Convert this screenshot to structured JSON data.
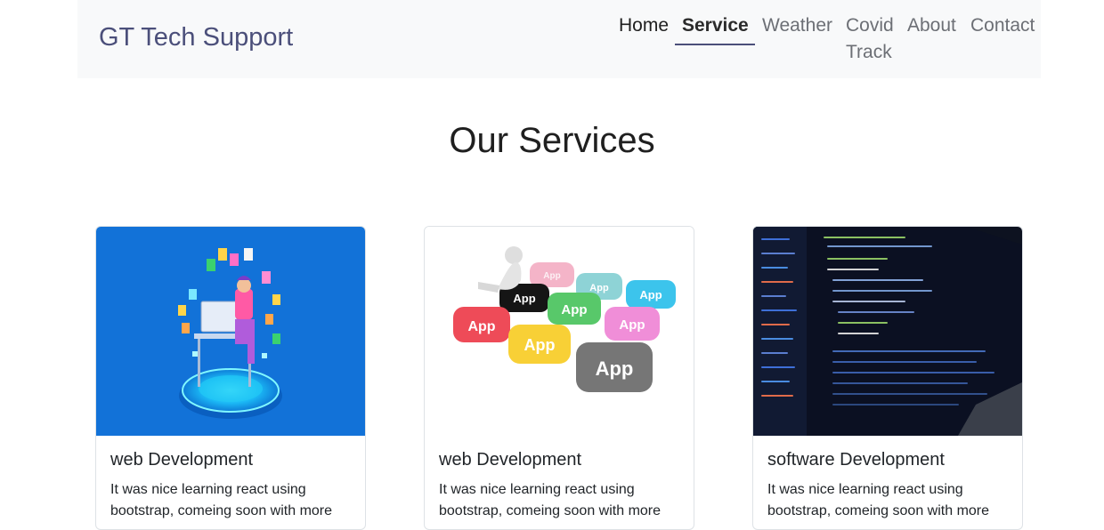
{
  "navbar": {
    "brand": "GT Tech Support",
    "links": [
      {
        "label": "Home"
      },
      {
        "label": "Service"
      },
      {
        "label": "Weather"
      },
      {
        "label": "Covid",
        "label2": "Track"
      },
      {
        "label": "About"
      },
      {
        "label": "Contact"
      }
    ]
  },
  "main": {
    "title": "Our Services",
    "cards": [
      {
        "title": "web Development",
        "text_line1": "It was nice learning react using",
        "text_line2": "bootstrap, comeing soon with more",
        "image": "developer-isometric-illustration"
      },
      {
        "title": "web Development",
        "text_line1": "It was nice learning react using",
        "text_line2": "bootstrap, comeing soon with more",
        "image": "app-keys-illustration"
      },
      {
        "title": "software Development",
        "text_line1": "It was nice learning react using",
        "text_line2": "bootstrap, comeing soon with more",
        "image": "code-on-laptop-photo"
      }
    ]
  },
  "colors": {
    "brand": "#4b4f7a",
    "navbar_bg": "#f8f9fa",
    "card1_bg": "#1272d8",
    "card3_bg": "#0d1220"
  }
}
